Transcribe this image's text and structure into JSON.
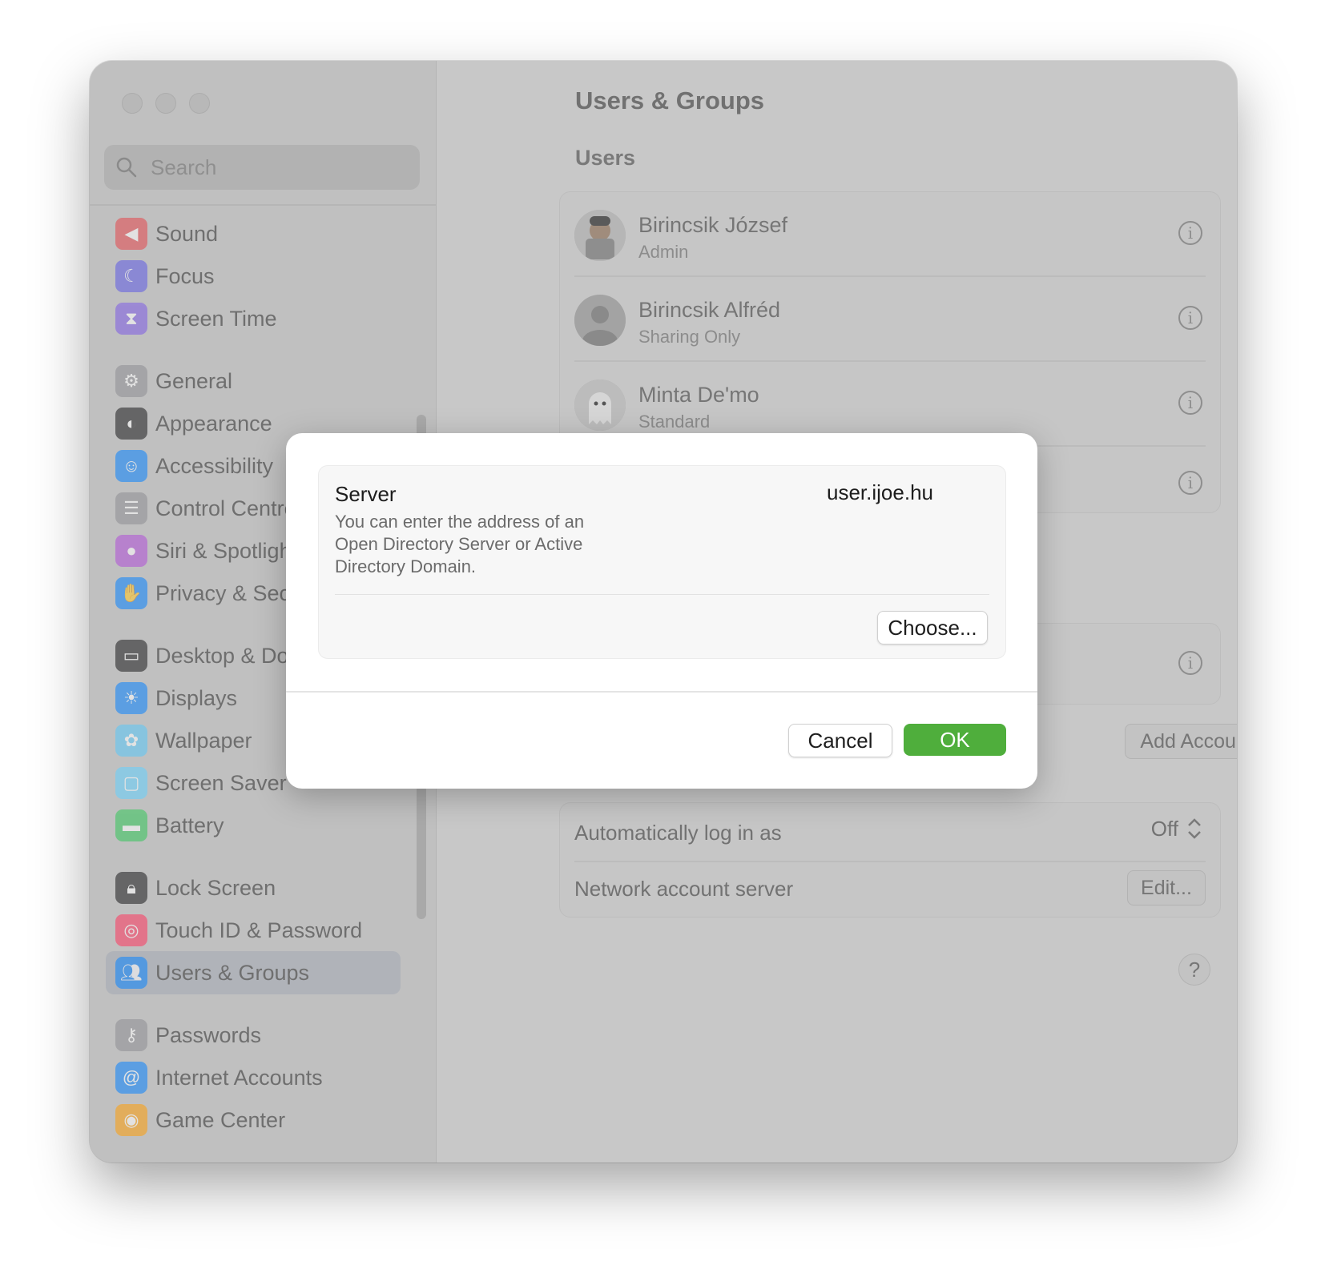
{
  "search": {
    "placeholder": "Search"
  },
  "sidebar": {
    "items": [
      {
        "label": "Sound",
        "color": "#e5484d",
        "icon": "speaker-icon"
      },
      {
        "label": "Focus",
        "color": "#5e5ce6",
        "icon": "moon-icon"
      },
      {
        "label": "Screen Time",
        "color": "#7d5ce6",
        "icon": "hourglass-icon"
      },
      {
        "label": "General",
        "color": "#8e8e93",
        "icon": "gear-icon"
      },
      {
        "label": "Appearance",
        "color": "#1c1c1e",
        "icon": "appearance-icon"
      },
      {
        "label": "Accessibility",
        "color": "#0a84ff",
        "icon": "accessibility-icon"
      },
      {
        "label": "Control Centre",
        "color": "#8e8e93",
        "icon": "toggles-icon"
      },
      {
        "label": "Siri & Spotlight",
        "color": "#b04fd8",
        "icon": "siri-icon"
      },
      {
        "label": "Privacy & Security",
        "color": "#0a84ff",
        "icon": "hand-icon"
      },
      {
        "label": "Desktop & Dock",
        "color": "#1c1c1e",
        "icon": "dock-icon"
      },
      {
        "label": "Displays",
        "color": "#0a84ff",
        "icon": "sun-icon"
      },
      {
        "label": "Wallpaper",
        "color": "#5ac8fa",
        "icon": "flower-icon"
      },
      {
        "label": "Screen Saver",
        "color": "#64d2ff",
        "icon": "screensaver-icon"
      },
      {
        "label": "Battery",
        "color": "#34c759",
        "icon": "battery-icon"
      },
      {
        "label": "Lock Screen",
        "color": "#1c1c1e",
        "icon": "lock-icon"
      },
      {
        "label": "Touch ID & Password",
        "color": "#ff375f",
        "icon": "fingerprint-icon"
      },
      {
        "label": "Users & Groups",
        "color": "#0a84ff",
        "icon": "users-icon"
      },
      {
        "label": "Passwords",
        "color": "#8e8e93",
        "icon": "key-icon"
      },
      {
        "label": "Internet Accounts",
        "color": "#0a84ff",
        "icon": "at-icon"
      },
      {
        "label": "Game Center",
        "color": "#ff9f0a",
        "icon": "game-center-icon"
      }
    ]
  },
  "main": {
    "title": "Users & Groups",
    "users_heading": "Users",
    "users": [
      {
        "name": "Birincsik József",
        "role": "Admin"
      },
      {
        "name": "Birincsik Alfréd",
        "role": "Sharing Only"
      },
      {
        "name": "Minta De'mo",
        "role": "Standard"
      }
    ],
    "info_glyph": "i",
    "add_account_label": "Add Account...",
    "auto_login_label": "Automatically log in as",
    "auto_login_value": "Off",
    "network_server_label": "Network account server",
    "edit_label": "Edit...",
    "help_label": "?"
  },
  "dialog": {
    "server_label": "Server",
    "server_description": "You can enter the address of an Open Directory Server or Active Directory Domain.",
    "server_value": "user.ijoe.hu",
    "choose_label": "Choose...",
    "cancel_label": "Cancel",
    "ok_label": "OK",
    "ok_color": "#4fae3c"
  }
}
